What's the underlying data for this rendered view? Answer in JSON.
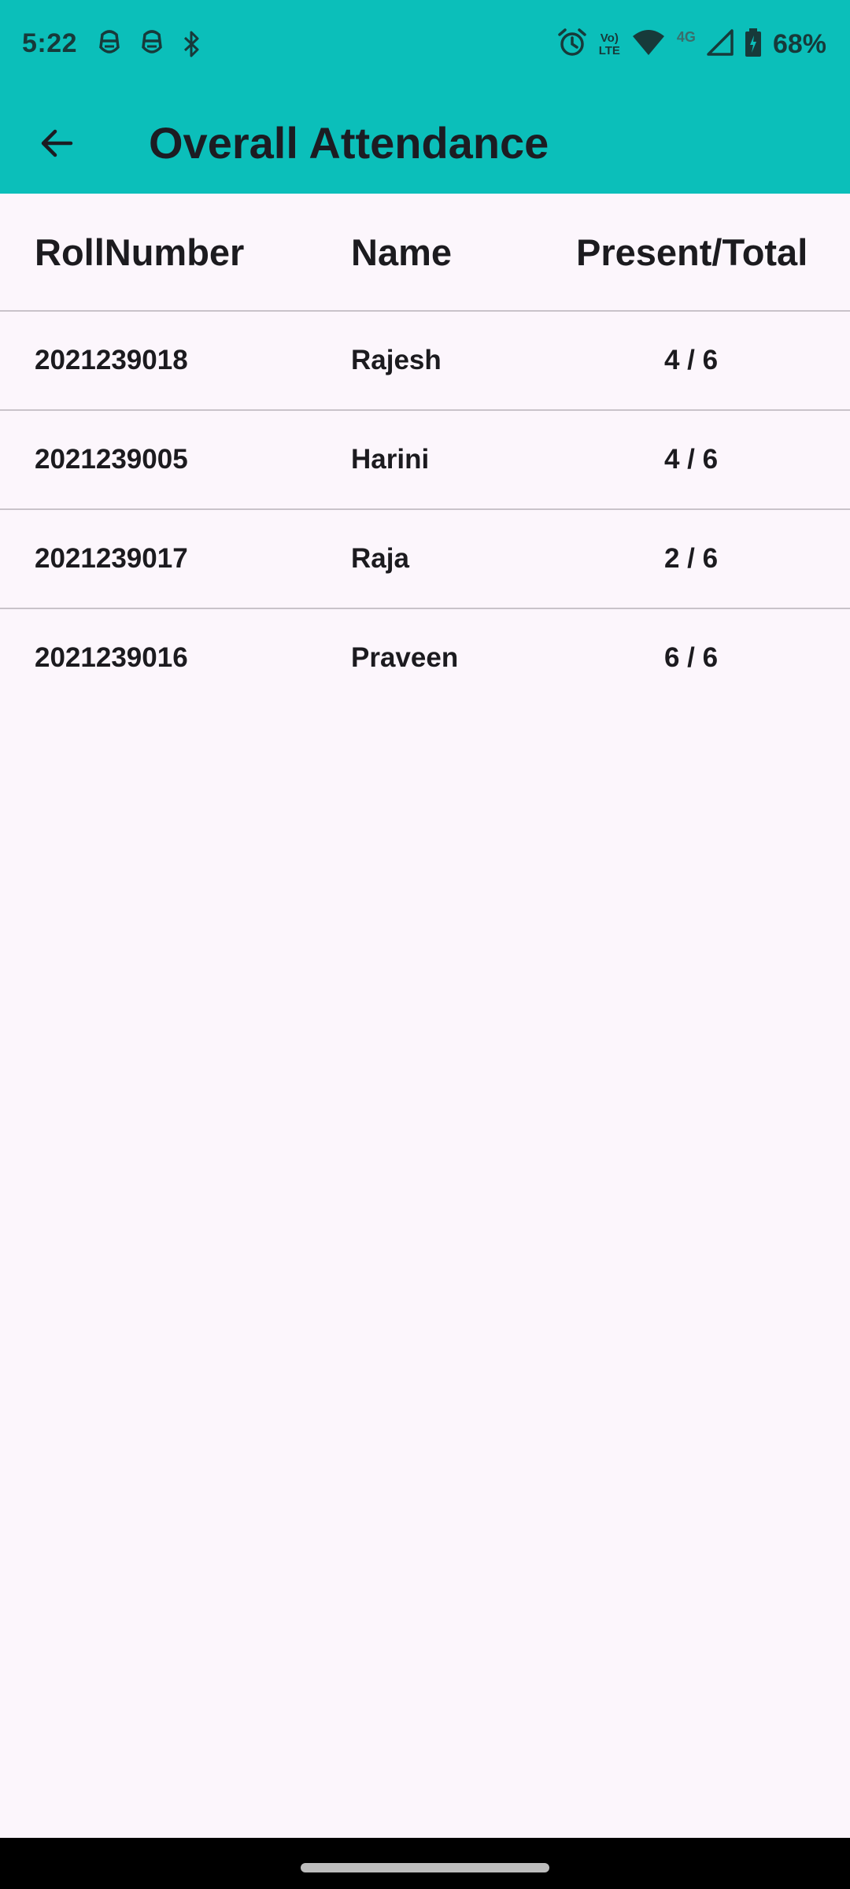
{
  "status_bar": {
    "time": "5:22",
    "battery_percent": "68%",
    "volte_line1": "Vo)",
    "volte_line2": "LTE",
    "network_type": "4G",
    "background": "#0bbfba"
  },
  "app_bar": {
    "title": "Overall Attendance",
    "back_icon": "arrow-back-icon",
    "background": "#0bbfba"
  },
  "table": {
    "headers": {
      "roll": "RollNumber",
      "name": "Name",
      "present_total": "Present/Total"
    },
    "rows": [
      {
        "roll": "2021239018",
        "name": "Rajesh",
        "present_total": "4 / 6"
      },
      {
        "roll": "2021239005",
        "name": "Harini",
        "present_total": "4 / 6"
      },
      {
        "roll": "2021239017",
        "name": "Raja",
        "present_total": "2 / 6"
      },
      {
        "roll": "2021239016",
        "name": "Praveen",
        "present_total": "6 / 6"
      }
    ]
  }
}
